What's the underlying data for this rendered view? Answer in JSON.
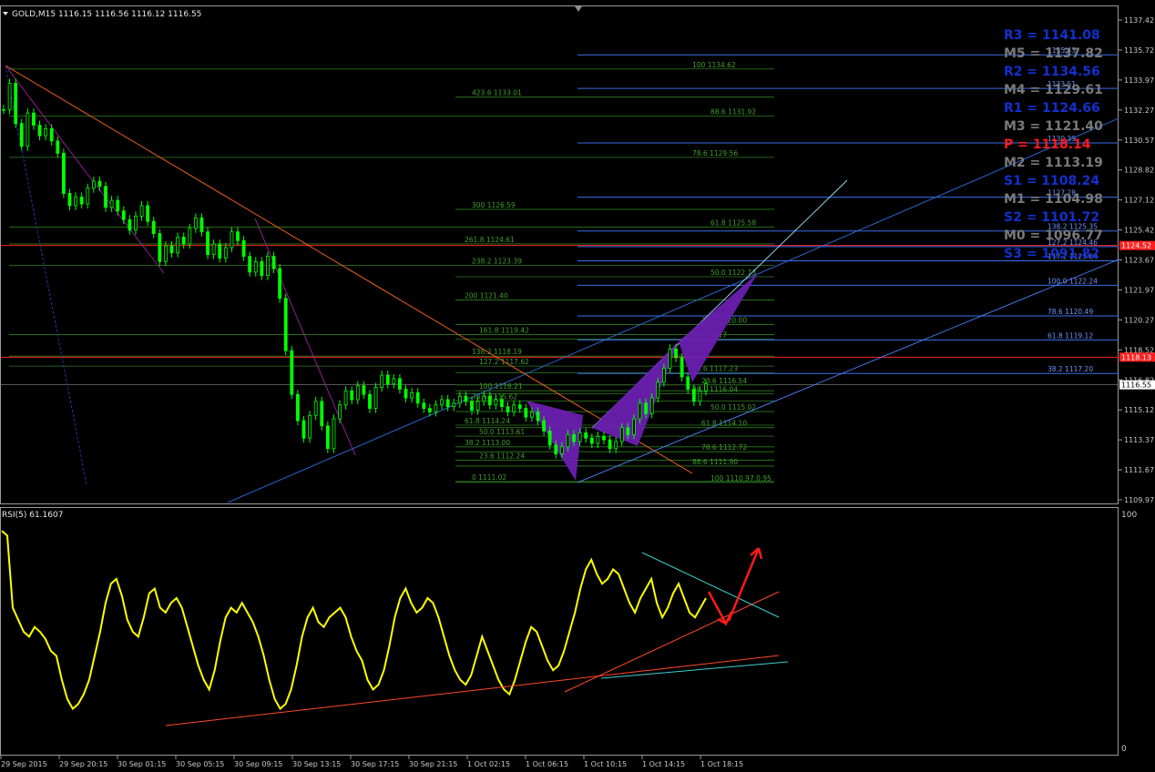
{
  "chart_data": [
    {
      "type": "line",
      "title": "GOLD,M15  1116.15 1116.56 1116.12 1116.55",
      "symbol": "GOLD,M15",
      "ohlc": {
        "open": "1116.15",
        "high": "1116.56",
        "low": "1116.12",
        "close": "1116.55"
      },
      "y_ticks": [
        "1137.42",
        "1135.72",
        "1133.97",
        "1132.27",
        "1130.57",
        "1128.82",
        "1127.12",
        "1125.42",
        "1123.67",
        "1121.97",
        "1120.27",
        "1118.52",
        "1116.82",
        "1115.12",
        "1113.37",
        "1111.67",
        "1109.97"
      ],
      "ylim": [
        1109.97,
        1137.42
      ],
      "current_price_label": "1116.55",
      "red_levels": [
        {
          "price": 1124.52,
          "label": "1124.52"
        },
        {
          "price": 1118.13,
          "label": "1118.13"
        }
      ],
      "pivots": [
        {
          "label": "R3 = 1141.08",
          "kind": "R"
        },
        {
          "label": "M5 = 1137.82",
          "kind": "M"
        },
        {
          "label": "R2 = 1134.56",
          "kind": "R"
        },
        {
          "label": "M4 = 1129.61",
          "kind": "M"
        },
        {
          "label": "R1 = 1124.66",
          "kind": "R"
        },
        {
          "label": "M3 = 1121.40",
          "kind": "M"
        },
        {
          "label": "P  = 1118.14",
          "kind": "P"
        },
        {
          "label": "M2 = 1113.19",
          "kind": "M"
        },
        {
          "label": "S1 = 1108.24",
          "kind": "R"
        },
        {
          "label": "M1 = 1104.98",
          "kind": "M"
        },
        {
          "label": "S2 = 1101.72",
          "kind": "R"
        },
        {
          "label": "M0 = 1096.77",
          "kind": "M"
        },
        {
          "label": "S3 = 1091.82",
          "kind": "R"
        }
      ],
      "fib_left": [
        {
          "price": 1134.62,
          "label": "100 1134.62"
        },
        {
          "price": 1133.01,
          "label": "423.6 1133.01"
        },
        {
          "price": 1131.92,
          "label": "88.6 1131.92"
        },
        {
          "price": 1129.56,
          "label": "78.6 1129.56"
        },
        {
          "price": 1126.59,
          "label": "300 1126.59"
        },
        {
          "price": 1125.58,
          "label": "61.8 1125.58"
        },
        {
          "price": 1124.61,
          "label": "261.8 1124.61"
        },
        {
          "price": 1123.39,
          "label": "238.2 1123.39"
        },
        {
          "price": 1122.73,
          "label": "50.0 1122.73"
        },
        {
          "price": 1121.4,
          "label": "200 1121.40"
        },
        {
          "price": 1120.0,
          "label": "38.2 1120.00"
        },
        {
          "price": 1119.42,
          "label": "161.8 1119.42"
        },
        {
          "price": 1119.17,
          "label": "0 1119.17"
        },
        {
          "price": 1118.19,
          "label": "138.2 1118.19"
        },
        {
          "price": 1117.62,
          "label": "127.2 1117.62"
        },
        {
          "price": 1117.23,
          "label": "23.6 1117.23"
        },
        {
          "price": 1116.54,
          "label": "23.6 1116.54"
        },
        {
          "price": 1116.21,
          "label": "100 1116.21"
        },
        {
          "price": 1116.04,
          "label": "38.2 1116.04"
        },
        {
          "price": 1115.62,
          "label": "78.6 1115.62"
        },
        {
          "price": 1115.02,
          "label": "50.0 1115.02"
        },
        {
          "price": 1114.24,
          "label": "61.8 1114.24"
        },
        {
          "price": 1114.1,
          "label": "61.8 1114.10"
        },
        {
          "price": 1113.61,
          "label": "50.0 1113.61"
        },
        {
          "price": 1113.0,
          "label": "38.2 1113.00"
        },
        {
          "price": 1112.72,
          "label": "78.6 1112.72"
        },
        {
          "price": 1112.24,
          "label": "23.6 1112.24"
        },
        {
          "price": 1111.9,
          "label": "88.6 1111.90"
        },
        {
          "price": 1111.02,
          "label": "0 1111.02"
        },
        {
          "price": 1110.97,
          "label": "100 1110.97.0.95"
        }
      ],
      "fib_right": [
        {
          "price": 1135.43,
          "label": "1135.43"
        },
        {
          "price": 1133.51,
          "label": "1133.51"
        },
        {
          "price": 1130.39,
          "label": "1130.39"
        },
        {
          "price": 1127.28,
          "label": "1127.28"
        },
        {
          "price": 1125.35,
          "label": "138.2 1125.35"
        },
        {
          "price": 1124.46,
          "label": "127.2 1124.46"
        },
        {
          "price": 1123.64,
          "label": "117.2 1123.64"
        },
        {
          "price": 1122.24,
          "label": "100.0 1122.24"
        },
        {
          "price": 1120.49,
          "label": "78.6 1120.49"
        },
        {
          "price": 1119.12,
          "label": "61.8 1119.12"
        },
        {
          "price": 1117.2,
          "label": "38.2 1117.20"
        }
      ],
      "price_path": [
        1132.3,
        1133.8,
        1131.5,
        1130.2,
        1132.1,
        1131.4,
        1130.8,
        1131.2,
        1130.5,
        1129.8,
        1127.5,
        1126.8,
        1127.3,
        1126.9,
        1127.8,
        1128.2,
        1127.9,
        1126.7,
        1127.1,
        1126.5,
        1126.0,
        1125.4,
        1126.2,
        1126.8,
        1125.9,
        1125.2,
        1123.6,
        1124.5,
        1124.1,
        1125.0,
        1124.6,
        1125.5,
        1126.1,
        1125.3,
        1124.0,
        1124.6,
        1123.8,
        1124.4,
        1125.3,
        1124.8,
        1123.9,
        1123.0,
        1123.6,
        1122.8,
        1123.9,
        1123.2,
        1121.5,
        1118.5,
        1116.0,
        1114.5,
        1113.5,
        1114.8,
        1115.6,
        1114.2,
        1112.9,
        1114.6,
        1115.4,
        1116.2,
        1115.7,
        1116.5,
        1116.0,
        1115.2,
        1116.4,
        1117.1,
        1116.6,
        1116.9,
        1116.3,
        1115.8,
        1116.1,
        1115.5,
        1115.2,
        1115.0,
        1115.4,
        1115.7,
        1115.3,
        1115.5,
        1115.9,
        1115.6,
        1115.1,
        1115.6,
        1115.9,
        1115.4,
        1115.7,
        1115.3,
        1115.0,
        1115.4,
        1115.2,
        1114.7,
        1115.0,
        1114.5,
        1113.9,
        1113.1,
        1112.6,
        1113.0,
        1113.7,
        1113.3,
        1113.8,
        1113.5,
        1113.2,
        1113.6,
        1113.4,
        1112.9,
        1113.3,
        1114.1,
        1113.7,
        1114.6,
        1115.5,
        1114.9,
        1115.8,
        1116.7,
        1117.5,
        1118.6,
        1118.1,
        1117.0,
        1116.3,
        1115.6,
        1116.2,
        1116.6
      ],
      "rsi": {
        "label": "RSI(5) 61.1607",
        "top": "100",
        "bottom": "0",
        "values": [
          92,
          90,
          60,
          55,
          50,
          48,
          52,
          50,
          47,
          42,
          40,
          30,
          22,
          18,
          20,
          24,
          30,
          40,
          50,
          62,
          70,
          72,
          65,
          55,
          50,
          48,
          56,
          66,
          68,
          60,
          58,
          62,
          64,
          60,
          52,
          44,
          36,
          30,
          26,
          34,
          46,
          56,
          60,
          58,
          62,
          58,
          54,
          48,
          40,
          30,
          22,
          18,
          20,
          26,
          36,
          48,
          56,
          60,
          54,
          52,
          56,
          58,
          60,
          56,
          48,
          42,
          38,
          30,
          26,
          28,
          34,
          44,
          56,
          64,
          68,
          62,
          58,
          60,
          64,
          62,
          56,
          48,
          40,
          34,
          30,
          28,
          32,
          40,
          48,
          42,
          36,
          30,
          26,
          24,
          30,
          38,
          46,
          52,
          50,
          44,
          38,
          34,
          36,
          42,
          50,
          58,
          68,
          76,
          80,
          74,
          70,
          72,
          76,
          74,
          68,
          62,
          58,
          64,
          68,
          72,
          62,
          56,
          60,
          66,
          70,
          64,
          58,
          56,
          60,
          64
        ]
      },
      "x_ticks": [
        "29 Sep 2015",
        "29 Sep 20:15",
        "30 Sep 01:15",
        "30 Sep 05:15",
        "30 Sep 09:15",
        "30 Sep 13:15",
        "30 Sep 17:15",
        "30 Sep 21:15",
        "1 Oct 02:15",
        "1 Oct 06:15",
        "1 Oct 10:15",
        "1 Oct 14:15",
        "1 Oct 18:15"
      ],
      "colors": {
        "background": "#000000",
        "bull_candle": "#00ff00",
        "fib_left": "#2f7d1f",
        "fib_right": "#3b6eea",
        "red_level": "#ff2020",
        "pivot_r": "#1230d0",
        "pivot_m": "#7a7a7a",
        "pivot_p": "#ff1a1a",
        "rsi_line": "#ffff00",
        "pattern": "#6a1fb0",
        "axis_text": "#c8c8c8"
      }
    }
  ]
}
